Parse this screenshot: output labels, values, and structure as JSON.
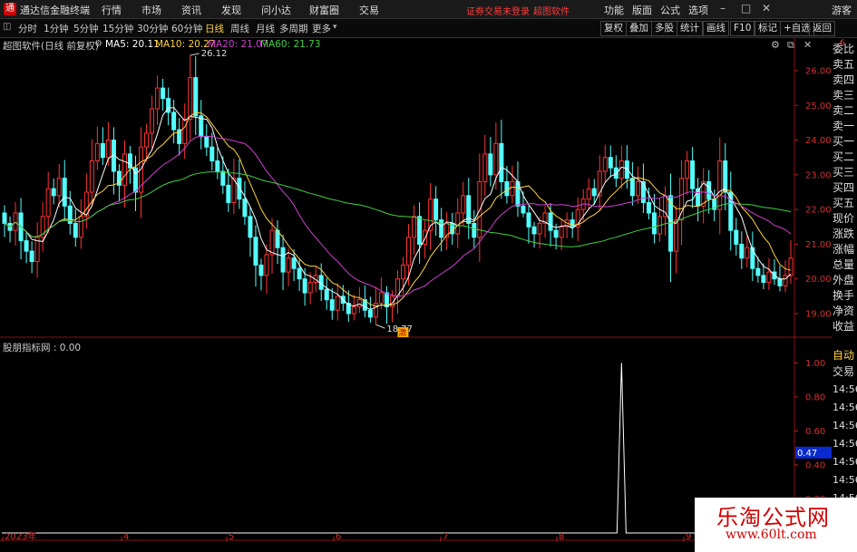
{
  "app": {
    "logo_glyph": "通",
    "title": "通达信金融终端",
    "menus": [
      "行情",
      "市场",
      "资讯",
      "发现",
      "问小达",
      "财富圈",
      "交易"
    ],
    "warning": "证券交易未登录",
    "warning_link": "超图软件",
    "right_menus": [
      "功能",
      "版面",
      "公式",
      "选项"
    ],
    "guest": "游客"
  },
  "toolbar": {
    "periods": [
      "分时",
      "1分钟",
      "5分钟",
      "15分钟",
      "30分钟",
      "60分钟",
      "日线",
      "周线",
      "月线",
      "多周期",
      "更多"
    ],
    "active": "日线",
    "right_buttons": [
      "复权",
      "叠加",
      "多股",
      "统计",
      "画线",
      "F10",
      "标记",
      "+自选",
      "返回"
    ]
  },
  "price_pane": {
    "title": "超图软件(日线 前复权)",
    "ma": [
      {
        "label": "MA5: 20.11",
        "color": "#ffffff"
      },
      {
        "label": "MA10: 20.27",
        "color": "#ffd23f"
      },
      {
        "label": "MA20: 21.07",
        "color": "#d040d0"
      },
      {
        "label": "MA60: 21.73",
        "color": "#40d040"
      }
    ],
    "high_label": "26.12",
    "low_label": "18.77",
    "marker": "激",
    "y_ticks": [
      "26.00",
      "25.00",
      "24.00",
      "23.00",
      "22.00",
      "21.00",
      "20.00",
      "19.00"
    ]
  },
  "indicator_pane": {
    "title": "股朋指标网 : 0.00",
    "y_ticks": [
      "1.00",
      "0.80",
      "0.60",
      "0.40",
      "0.20"
    ],
    "current_value": "0.47"
  },
  "x_axis": [
    "2023年",
    "4",
    "5",
    "6",
    "7",
    "8",
    "9"
  ],
  "side_panel": {
    "quote_labels": [
      "委比",
      "卖五",
      "卖四",
      "卖三",
      "卖二",
      "卖一",
      "买一",
      "买二",
      "买三",
      "买四",
      "买五",
      "现价",
      "涨跌",
      "涨幅",
      "总量",
      "外盘",
      "换手",
      "净资",
      "收益"
    ],
    "lower_labels": [
      "自动",
      "交易"
    ],
    "times": [
      "14:56",
      "14:56",
      "14:56",
      "14:56",
      "14:56",
      "14:56",
      "14:56",
      "14:56"
    ],
    "top_tag_red": "6"
  },
  "brand": {
    "name": "乐淘公式网",
    "url": "www.60lt.com"
  },
  "chart_data": {
    "type": "candlestick",
    "price_ylim": [
      18.4,
      26.6
    ],
    "indicator_ylim": [
      0,
      1.05
    ],
    "indicator_spike": {
      "index": 113,
      "value": 1.0
    },
    "candles_close": [
      21.6,
      21.4,
      21.9,
      21.1,
      20.8,
      20.5,
      21.2,
      21.8,
      22.6,
      22.4,
      22.9,
      22.1,
      21.6,
      21.2,
      21.8,
      22.5,
      23.4,
      23.9,
      23.5,
      24.0,
      23.1,
      22.7,
      23.6,
      23.2,
      22.5,
      23.8,
      24.2,
      24.9,
      25.5,
      25.2,
      24.8,
      24.3,
      23.9,
      24.6,
      25.8,
      24.7,
      24.1,
      23.8,
      23.4,
      23.1,
      22.7,
      22.2,
      22.9,
      22.3,
      21.8,
      21.2,
      20.4,
      20.1,
      20.7,
      21.4,
      20.9,
      20.2,
      20.6,
      20.3,
      20.0,
      19.6,
      19.9,
      20.1,
      19.7,
      19.4,
      19.1,
      19.5,
      19.3,
      19.0,
      19.2,
      19.4,
      19.1,
      18.9,
      19.3,
      19.6,
      19.2,
      19.5,
      20.0,
      20.4,
      21.2,
      21.8,
      21.0,
      21.4,
      22.3,
      21.7,
      21.2,
      21.6,
      21.3,
      21.9,
      22.4,
      21.6,
      21.2,
      22.8,
      23.6,
      23.0,
      23.9,
      22.8,
      22.4,
      22.8,
      22.1,
      21.9,
      21.5,
      21.3,
      21.6,
      21.9,
      21.4,
      21.2,
      21.5,
      21.7,
      21.5,
      22.0,
      22.3,
      22.6,
      22.4,
      23.1,
      23.5,
      23.2,
      22.9,
      23.4,
      22.9,
      22.4,
      22.8,
      22.2,
      21.9,
      21.3,
      21.8,
      22.4,
      20.8,
      21.7,
      22.9,
      23.4,
      22.6,
      22.1,
      22.8,
      22.3,
      22.0,
      23.4,
      22.5,
      21.4,
      21.0,
      20.6,
      20.9,
      20.3,
      20.1,
      19.9,
      20.2,
      20.0,
      19.8,
      20.1,
      20.6
    ]
  }
}
